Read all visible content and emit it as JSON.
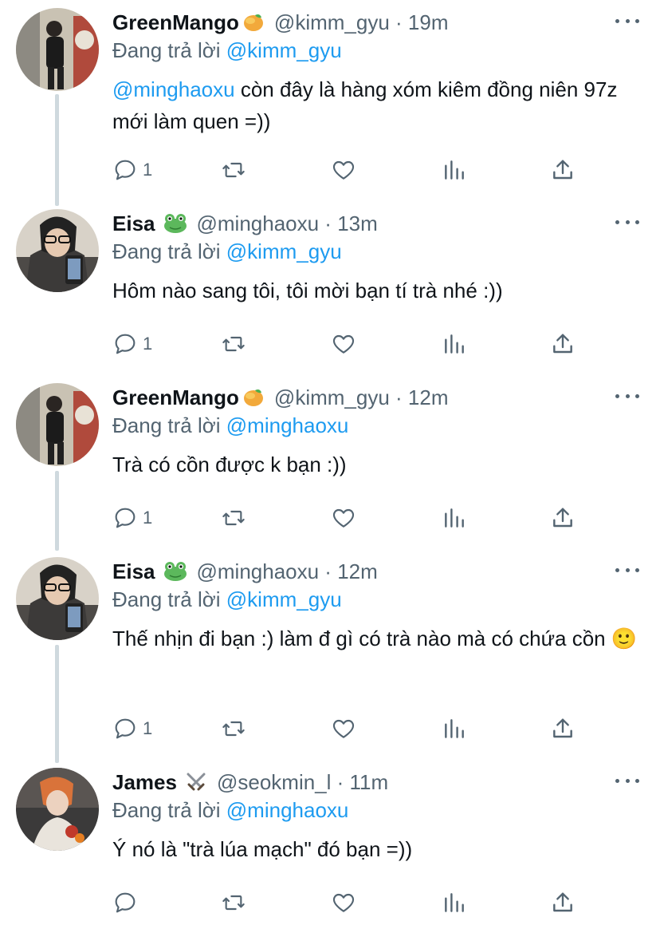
{
  "colors": {
    "accent": "#1d9bf0",
    "secondary_text": "#536471",
    "thread_line": "#cfd9de"
  },
  "tweets": [
    {
      "name": "GreenMango",
      "emoji": "mango",
      "handle_time": "@kimm_gyu · 19m",
      "replying_prefix": "Đang trả lời ",
      "replying_to": "@kimm_gyu",
      "body_mention": "@minghaoxu",
      "body_text": " còn đây là hàng xóm kiêm đồng niên 97z mới làm quen =))",
      "reply_count": "1"
    },
    {
      "name": "Eisa",
      "emoji": "frog",
      "handle_time": "@minghaoxu · 13m",
      "replying_prefix": "Đang trả lời ",
      "replying_to": "@kimm_gyu",
      "body_mention": "",
      "body_text": "Hôm nào sang tôi, tôi mời bạn tí trà nhé :))",
      "reply_count": "1"
    },
    {
      "name": "GreenMango",
      "emoji": "mango",
      "handle_time": "@kimm_gyu · 12m",
      "replying_prefix": "Đang trả lời ",
      "replying_to": "@minghaoxu",
      "body_mention": "",
      "body_text": "Trà có cồn được k bạn :))",
      "reply_count": "1"
    },
    {
      "name": "Eisa",
      "emoji": "frog",
      "handle_time": "@minghaoxu · 12m",
      "replying_prefix": "Đang trả lời ",
      "replying_to": "@kimm_gyu",
      "body_mention": "",
      "body_text": "Thế nhịn đi bạn :) làm đ gì có trà nào mà có chứa cồn 🙂",
      "reply_count": "1"
    },
    {
      "name": "James",
      "emoji": "crossed-swords",
      "handle_time": "@seokmin_l · 11m",
      "replying_prefix": "Đang trả lời ",
      "replying_to": "@minghaoxu",
      "body_mention": "",
      "body_text": "Ý nó là \"trà lúa mạch\" đó bạn =))",
      "reply_count": ""
    }
  ]
}
